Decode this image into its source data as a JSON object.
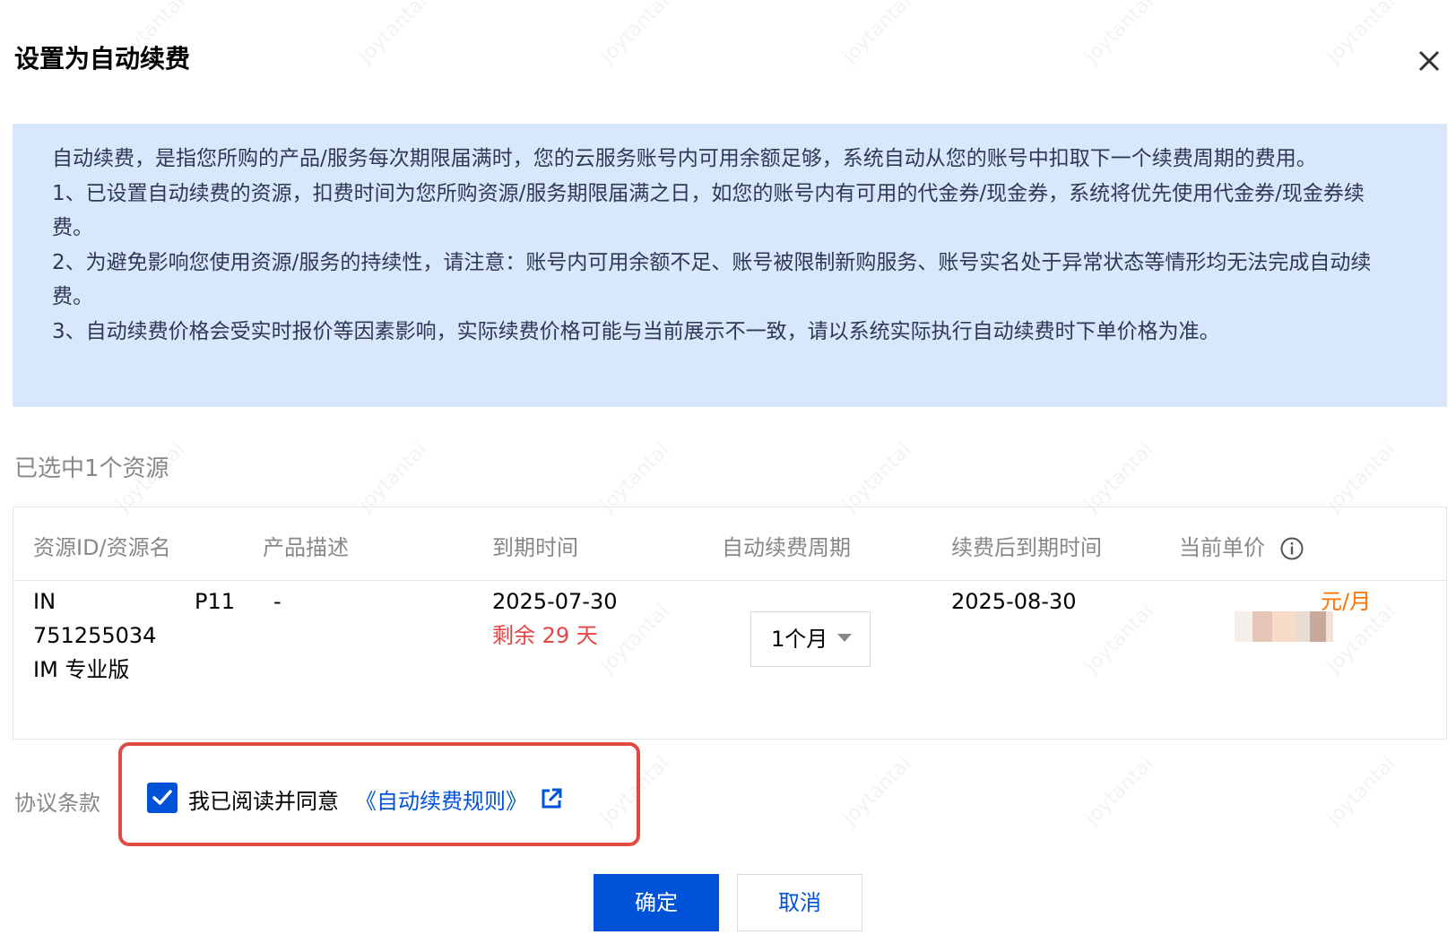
{
  "dialog": {
    "title": "设置为自动续费",
    "close_icon": "close-icon"
  },
  "notice": {
    "lines": [
      "自动续费，是指您所购的产品/服务每次期限届满时，您的云服务账号内可用余额足够，系统自动从您的账号中扣取下一个续费周期的费用。",
      "1、已设置自动续费的资源，扣费时间为您所购资源/服务期限届满之日，如您的账号内有可用的代金券/现金券，系统将优先使用代金券/现金券续费。",
      "2、为避免影响您使用资源/服务的持续性，请注意：账号内可用余额不足、账号被限制新购服务、账号实名处于异常状态等情形均无法完成自动续费。",
      "3、自动续费价格会受实时报价等因素影响，实际续费价格可能与当前展示不一致，请以系统实际执行自动续费时下单价格为准。"
    ]
  },
  "selection": {
    "count_text": "已选中1个资源"
  },
  "table": {
    "headers": [
      "资源ID/资源名",
      "产品描述",
      "到期时间",
      "自动续费周期",
      "续费后到期时间",
      "当前单价"
    ],
    "info_icon": "info-circle-icon",
    "row": {
      "resource_id_prefix": "IN",
      "resource_id_suffix": "P11",
      "resource_id_line2": "751255034",
      "resource_name": "IM 专业版",
      "product_desc": "-",
      "expire_date": "2025-07-30",
      "remaining": "剩余 29 天",
      "period_value": "1个月",
      "renewed_expire_date": "2025-08-30",
      "price_unit": "元/月"
    }
  },
  "agreement": {
    "label": "协议条款",
    "checked": true,
    "text": "我已阅读并同意",
    "link_text": "《自动续费规则》",
    "link_icon": "external-link-icon"
  },
  "buttons": {
    "ok": "确定",
    "cancel": "取消"
  },
  "watermark": "joytantai",
  "colors": {
    "primary": "#0052d9",
    "notice_bg": "#d9e7fd",
    "warning_red": "#e54545",
    "price_orange": "#ff7200",
    "highlight_border": "#e04a45"
  }
}
